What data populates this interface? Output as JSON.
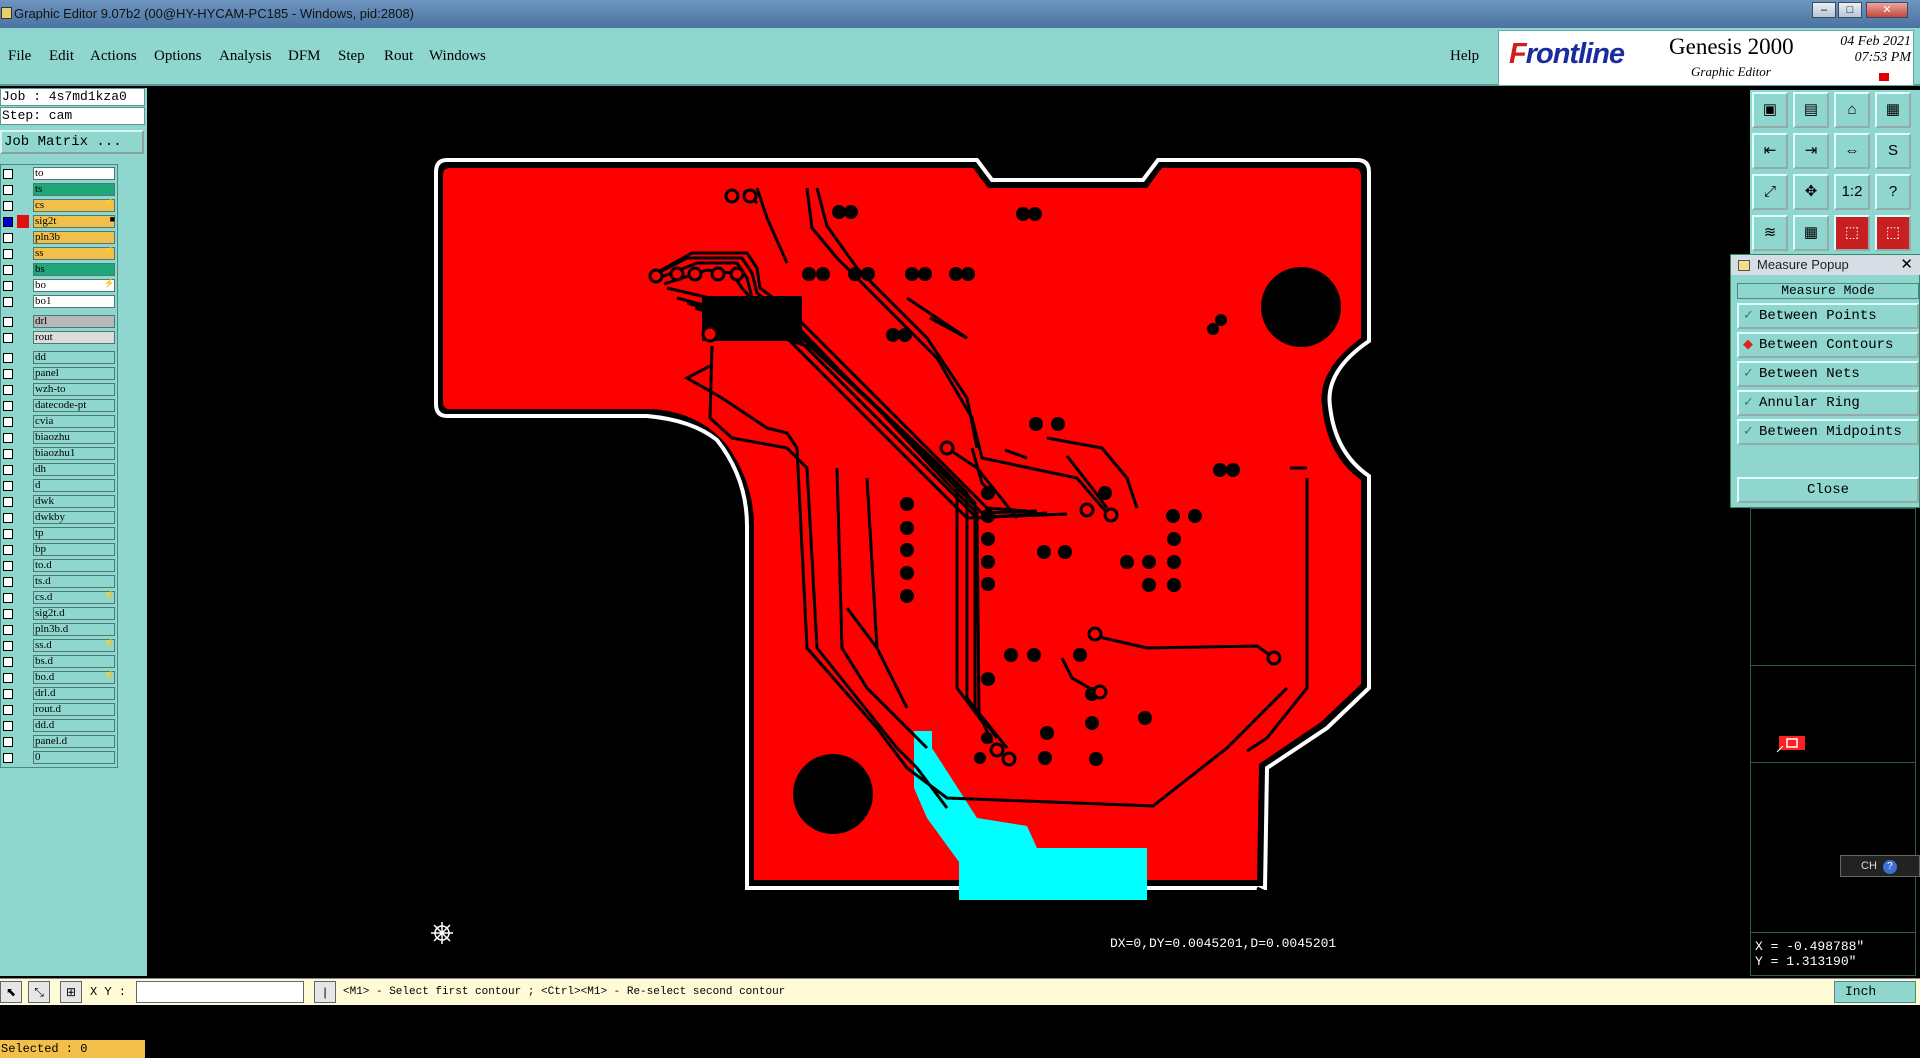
{
  "window": {
    "title": "Graphic Editor 9.07b2 (00@HY-HYCAM-PC185 - Windows, pid:2808)",
    "min": "–",
    "max": "□",
    "close": "✕"
  },
  "menu": {
    "items": [
      "File",
      "Edit",
      "Actions",
      "Options",
      "Analysis",
      "DFM",
      "Step",
      "Rout",
      "Windows"
    ],
    "help": "Help"
  },
  "brand": {
    "logo_f": "F",
    "logo_rest": "rontline",
    "product": "Genesis 2000",
    "subtitle": "Graphic Editor",
    "date": "04 Feb 2021",
    "time": "07:53 PM"
  },
  "left": {
    "job": "Job : 4s7md1kza0",
    "step": "Step: cam",
    "job_matrix": "Job Matrix ...",
    "selected": "Selected : 0",
    "layers": [
      {
        "name": "to",
        "color": "#ffffff",
        "swatch": "",
        "flag": ""
      },
      {
        "name": "ts",
        "color": "#1fa77a",
        "swatch": "",
        "flag": ""
      },
      {
        "name": "cs",
        "color": "#f2c04a",
        "swatch": "",
        "flag": "⚡"
      },
      {
        "name": "sig2t",
        "color": "#f2c04a",
        "swatch": "#e01010",
        "flag": "■",
        "checked": true
      },
      {
        "name": "pln3b",
        "color": "#f2c04a",
        "swatch": "",
        "flag": ""
      },
      {
        "name": "ss",
        "color": "#f2c04a",
        "swatch": "",
        "flag": "⚡"
      },
      {
        "name": "bs",
        "color": "#1fa77a",
        "swatch": "",
        "flag": ""
      },
      {
        "name": "bo",
        "color": "#ffffff",
        "swatch": "",
        "flag": "⚡"
      },
      {
        "name": "bo1",
        "color": "#ffffff",
        "swatch": "",
        "flag": ""
      },
      {
        "name": "drl",
        "color": "#b8b8b8",
        "swatch": "",
        "flag": ""
      },
      {
        "name": "rout",
        "color": "#dcdcdc",
        "swatch": "",
        "flag": ""
      },
      {
        "name": "dd",
        "color": "#8fd6cf",
        "swatch": "",
        "flag": ""
      },
      {
        "name": "panel",
        "color": "#8fd6cf",
        "swatch": "",
        "flag": ""
      },
      {
        "name": "wzh-to",
        "color": "#8fd6cf",
        "swatch": "",
        "flag": ""
      },
      {
        "name": "datecode-pt",
        "color": "#8fd6cf",
        "swatch": "",
        "flag": ""
      },
      {
        "name": "cvia",
        "color": "#8fd6cf",
        "swatch": "",
        "flag": ""
      },
      {
        "name": "biaozhu",
        "color": "#8fd6cf",
        "swatch": "",
        "flag": ""
      },
      {
        "name": "biaozhu1",
        "color": "#8fd6cf",
        "swatch": "",
        "flag": ""
      },
      {
        "name": "dh",
        "color": "#8fd6cf",
        "swatch": "",
        "flag": ""
      },
      {
        "name": "d",
        "color": "#8fd6cf",
        "swatch": "",
        "flag": ""
      },
      {
        "name": "dwk",
        "color": "#8fd6cf",
        "swatch": "",
        "flag": ""
      },
      {
        "name": "dwkby",
        "color": "#8fd6cf",
        "swatch": "",
        "flag": ""
      },
      {
        "name": "tp",
        "color": "#8fd6cf",
        "swatch": "",
        "flag": ""
      },
      {
        "name": "bp",
        "color": "#8fd6cf",
        "swatch": "",
        "flag": ""
      },
      {
        "name": "to.d",
        "color": "#8fd6cf",
        "swatch": "",
        "flag": ""
      },
      {
        "name": "ts.d",
        "color": "#8fd6cf",
        "swatch": "",
        "flag": ""
      },
      {
        "name": "cs.d",
        "color": "#8fd6cf",
        "swatch": "",
        "flag": "⚡"
      },
      {
        "name": "sig2t.d",
        "color": "#8fd6cf",
        "swatch": "",
        "flag": ""
      },
      {
        "name": "pln3b.d",
        "color": "#8fd6cf",
        "swatch": "",
        "flag": ""
      },
      {
        "name": "ss.d",
        "color": "#8fd6cf",
        "swatch": "",
        "flag": "⚡"
      },
      {
        "name": "bs.d",
        "color": "#8fd6cf",
        "swatch": "",
        "flag": ""
      },
      {
        "name": "bo.d",
        "color": "#8fd6cf",
        "swatch": "",
        "flag": "⚡"
      },
      {
        "name": "drl.d",
        "color": "#8fd6cf",
        "swatch": "",
        "flag": ""
      },
      {
        "name": "rout.d",
        "color": "#8fd6cf",
        "swatch": "",
        "flag": ""
      },
      {
        "name": "dd.d",
        "color": "#8fd6cf",
        "swatch": "",
        "flag": ""
      },
      {
        "name": "panel.d",
        "color": "#8fd6cf",
        "swatch": "",
        "flag": ""
      },
      {
        "name": "0",
        "color": "#8fd6cf",
        "swatch": "",
        "flag": ""
      }
    ]
  },
  "canvas": {
    "measure_readout": "DX=0,DY=0.0045201,D=0.0045201",
    "board_color": "#ff0000",
    "highlight_color": "#00ffff"
  },
  "toolbox": {
    "buttons": [
      "▣",
      "▤",
      "⌂",
      "▦",
      "⇤",
      "⇥",
      "⇔",
      "S",
      "⤢",
      "✥",
      "1:2",
      "?",
      "≋",
      "▦",
      "⬚",
      "⬚"
    ]
  },
  "popup": {
    "title": "Measure Popup",
    "close_x": "✕",
    "header": "Measure Mode",
    "options": [
      {
        "label": "Between Points",
        "selected": false
      },
      {
        "label": "Between Contours",
        "selected": true
      },
      {
        "label": "Between Nets",
        "selected": false
      },
      {
        "label": "Annular Ring",
        "selected": false
      },
      {
        "label": "Between Midpoints",
        "selected": false
      }
    ],
    "close_button": "Close"
  },
  "coords": {
    "x": "X = -0.498788\"",
    "y": "Y = 1.313190\""
  },
  "ch_widget": {
    "label": "CH",
    "help": "?"
  },
  "status": {
    "xy_label": "X Y :",
    "xy_value": "",
    "hint": "<M1> - Select first contour ; <Ctrl><M1> - Re-select second contour",
    "units": "Inch"
  }
}
